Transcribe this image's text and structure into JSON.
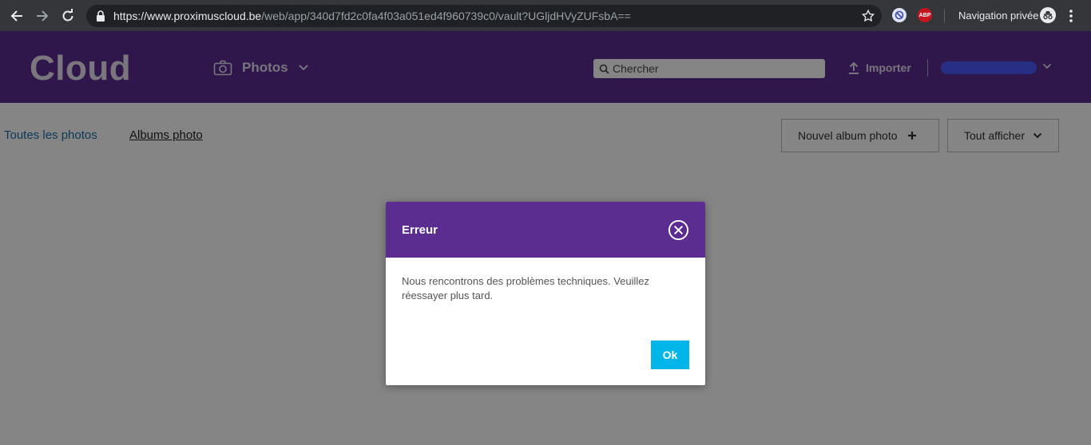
{
  "browser": {
    "url_host": "https://www.proximuscloud.be",
    "url_path": "/web/app/340d7fd2c0fa4f03a051ed4f960739c0/vault?UGljdHVyZUFsbA==",
    "ext_abp_label": "ABP",
    "incognito_label": "Navigation privée"
  },
  "header": {
    "logo": "Cloud",
    "section_label": "Photos",
    "search_placeholder": "Chercher",
    "import_label": "Importer"
  },
  "tabs": {
    "all_photos": "Toutes les photos",
    "albums": "Albums photo"
  },
  "toolbar": {
    "new_album": "Nouvel album photo",
    "show_all": "Tout afficher"
  },
  "dialog": {
    "title": "Erreur",
    "message": "Nous rencontrons des problèmes techniques. Veuillez réessayer plus tard.",
    "ok_label": "Ok"
  },
  "colors": {
    "brand_purple": "#5c2d91",
    "ok_button": "#00b6e8"
  }
}
